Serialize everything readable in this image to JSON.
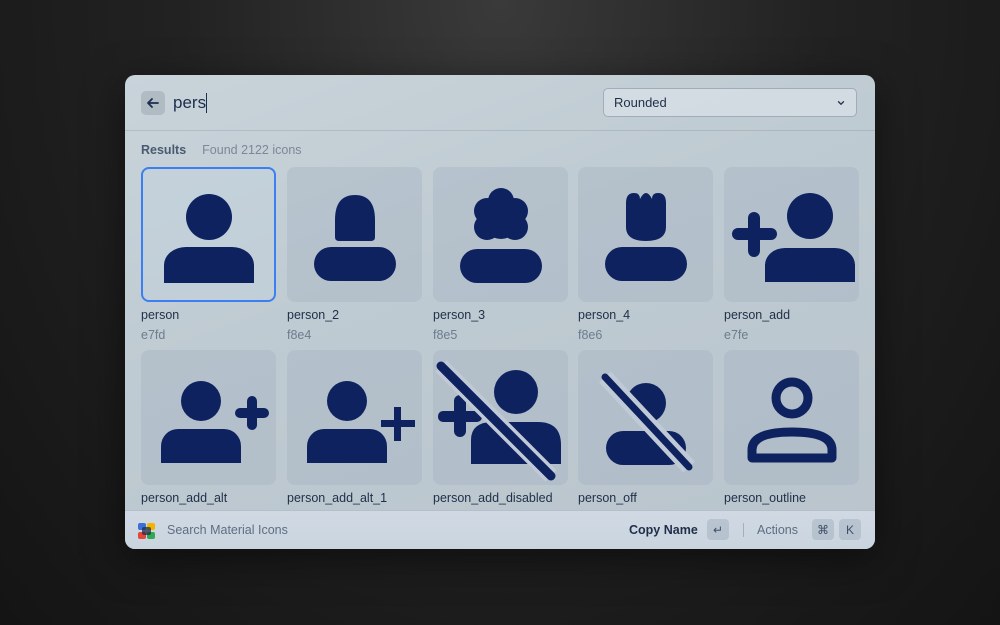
{
  "search": {
    "query": "pers"
  },
  "style_select": {
    "selected": "Rounded"
  },
  "results": {
    "label": "Results",
    "found_text": "Found 2122 icons",
    "items": [
      {
        "name": "person",
        "code": "e7fd",
        "icon": "person-icon",
        "selected": true
      },
      {
        "name": "person_2",
        "code": "f8e4",
        "icon": "person-2-icon"
      },
      {
        "name": "person_3",
        "code": "f8e5",
        "icon": "person-3-icon"
      },
      {
        "name": "person_4",
        "code": "f8e6",
        "icon": "person-4-icon"
      },
      {
        "name": "person_add",
        "code": "e7fe",
        "icon": "person-add-icon"
      },
      {
        "name": "person_add_alt",
        "code": "",
        "icon": "person-add-alt-icon"
      },
      {
        "name": "person_add_alt_1",
        "code": "",
        "icon": "person-add-alt-1-icon"
      },
      {
        "name": "person_add_disabled",
        "code": "",
        "icon": "person-add-disabled-icon"
      },
      {
        "name": "person_off",
        "code": "",
        "icon": "person-off-icon"
      },
      {
        "name": "person_outline",
        "code": "",
        "icon": "person-outline-icon"
      }
    ]
  },
  "footer": {
    "app_name": "Search Material Icons",
    "primary_action": "Copy Name",
    "primary_key": "↵",
    "actions_label": "Actions",
    "actions_keys": [
      "⌘",
      "K"
    ]
  },
  "colors": {
    "icon_fill": "#0e2260",
    "selection_border": "#3b7ff0"
  }
}
